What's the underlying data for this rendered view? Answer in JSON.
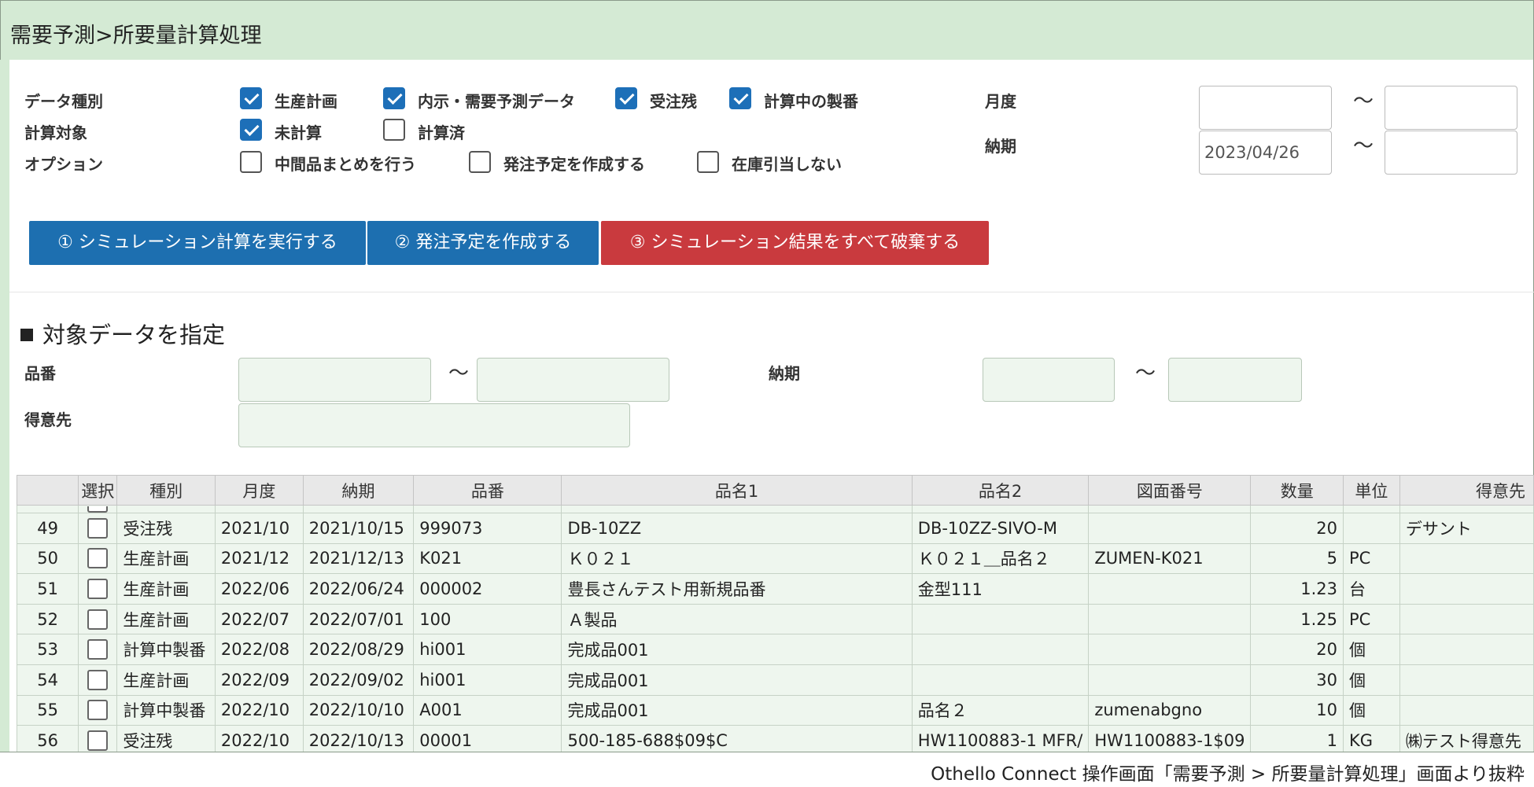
{
  "title": "需要予測>所要量計算処理",
  "filters": {
    "data_type_label": "データ種別",
    "calc_target_label": "計算対象",
    "option_label": "オプション",
    "data_types": [
      {
        "label": "生産計画",
        "checked": true
      },
      {
        "label": "内示・需要予測データ",
        "checked": true
      },
      {
        "label": "受注残",
        "checked": true
      },
      {
        "label": "計算中の製番",
        "checked": true
      }
    ],
    "calc_targets": [
      {
        "label": "未計算",
        "checked": true
      },
      {
        "label": "計算済",
        "checked": false
      }
    ],
    "options": [
      {
        "label": "中間品まとめを行う",
        "checked": false
      },
      {
        "label": "発注予定を作成する",
        "checked": false
      },
      {
        "label": "在庫引当しない",
        "checked": false
      }
    ],
    "month_label": "月度",
    "month_from": "",
    "month_to": "",
    "due_label": "納期",
    "due_from": "2023/04/26",
    "due_to": "",
    "tilde": "～"
  },
  "actions": {
    "run_simulation": "① シミュレーション計算を実行する",
    "create_order_plan": "② 発注予定を作成する",
    "discard_results": "③ シミュレーション結果をすべて破棄する"
  },
  "target_section": {
    "title": "対象データを指定",
    "item_no_label": "品番",
    "item_no_from": "",
    "item_no_to": "",
    "due_label": "納期",
    "due_from": "",
    "due_to": "",
    "customer_label": "得意先",
    "customer": ""
  },
  "table": {
    "columns": [
      "",
      "選択",
      "種別",
      "月度",
      "納期",
      "品番",
      "品名1",
      "品名2",
      "図面番号",
      "数量",
      "単位",
      "得意先"
    ],
    "rows": [
      {
        "no": "49",
        "type": "受注残",
        "month": "2021/10",
        "due": "2021/10/15",
        "item_no": "999073",
        "name1": "DB-10ZZ",
        "name2": "DB-10ZZ-SIVO-M",
        "drawing": "",
        "qty": "20",
        "unit": "",
        "customer": "デサント"
      },
      {
        "no": "50",
        "type": "生産計画",
        "month": "2021/12",
        "due": "2021/12/13",
        "item_no": "K021",
        "name1": "Ｋ０２１",
        "name2": "Ｋ０２１＿品名２",
        "drawing": "ZUMEN-K021",
        "qty": "5",
        "unit": "PC",
        "customer": ""
      },
      {
        "no": "51",
        "type": "生産計画",
        "month": "2022/06",
        "due": "2022/06/24",
        "item_no": "000002",
        "name1": "豊長さんテスト用新規品番",
        "name2": "金型111",
        "drawing": "",
        "qty": "1.23",
        "unit": "台",
        "customer": ""
      },
      {
        "no": "52",
        "type": "生産計画",
        "month": "2022/07",
        "due": "2022/07/01",
        "item_no": "100",
        "name1": "Ａ製品",
        "name2": "",
        "drawing": "",
        "qty": "1.25",
        "unit": "PC",
        "customer": ""
      },
      {
        "no": "53",
        "type": "計算中製番",
        "month": "2022/08",
        "due": "2022/08/29",
        "item_no": "hi001",
        "name1": "完成品001",
        "name2": "",
        "drawing": "",
        "qty": "20",
        "unit": "個",
        "customer": ""
      },
      {
        "no": "54",
        "type": "生産計画",
        "month": "2022/09",
        "due": "2022/09/02",
        "item_no": "hi001",
        "name1": "完成品001",
        "name2": "",
        "drawing": "",
        "qty": "30",
        "unit": "個",
        "customer": ""
      },
      {
        "no": "55",
        "type": "計算中製番",
        "month": "2022/10",
        "due": "2022/10/10",
        "item_no": "A001",
        "name1": "完成品001",
        "name2": "品名２",
        "drawing": "zumenabgno",
        "qty": "10",
        "unit": "個",
        "customer": ""
      },
      {
        "no": "56",
        "type": "受注残",
        "month": "2022/10",
        "due": "2022/10/13",
        "item_no": "00001",
        "name1": "500-185-688$09$C",
        "name2": "HW1100883-1 MFR/",
        "drawing": "HW1100883-1$09",
        "qty": "1",
        "unit": "KG",
        "customer": "㈱テスト得意先"
      }
    ]
  },
  "footer_caption": "Othello Connect 操作画面「需要予測 > 所要量計算処理」画面より抜粋",
  "colors": {
    "primary": "#1d6fb0",
    "danger": "#c93a3e",
    "header_bg": "#d4ead4",
    "row_bg": "#eef6ee"
  }
}
